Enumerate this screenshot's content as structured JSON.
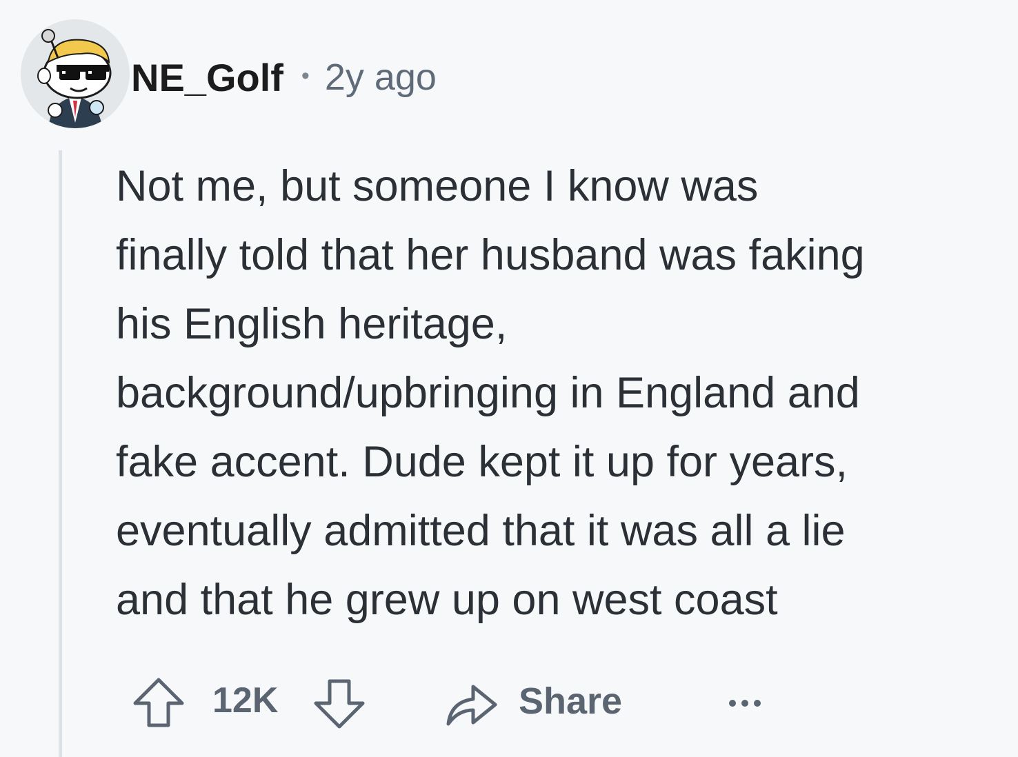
{
  "comment": {
    "author": "NE_Golf",
    "separator": "•",
    "age": "2y ago",
    "body_lines": [
      "Not me, but someone I know was",
      "finally told that her husband was faking",
      "his English heritage,",
      "background/upbringing in England and",
      "fake accent. Dude kept it up for years,",
      "eventually admitted that it was all a lie",
      "and that he grew up on west coast"
    ],
    "actions": {
      "score": "12K",
      "share_label": "Share",
      "upvote_icon": "arrow-up-outline-icon",
      "downvote_icon": "arrow-down-outline-icon",
      "share_icon": "share-arrow-icon",
      "more_icon": "ellipsis-icon"
    },
    "avatar_icon": "snoo-avatar-with-sunglasses"
  },
  "colors": {
    "background": "#f7f8fa",
    "text": "#2b3036",
    "muted": "#5b6571",
    "thread_line": "#dde2e8"
  }
}
